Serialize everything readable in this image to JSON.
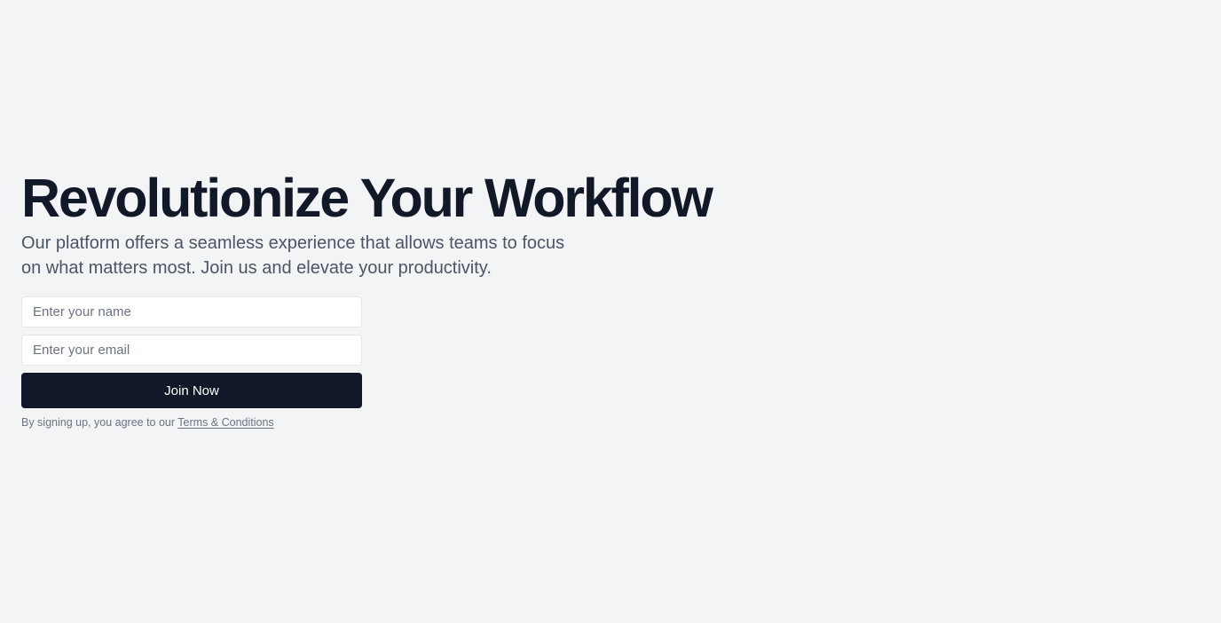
{
  "hero": {
    "title": "Revolutionize Your Workflow",
    "subtitle": "Our platform offers a seamless experience that allows teams to focus on what matters most. Join us and elevate your productivity."
  },
  "form": {
    "name_placeholder": "Enter your name",
    "email_placeholder": "Enter your email",
    "submit_label": "Join Now"
  },
  "legal": {
    "prefix": "By signing up, you agree to our",
    "link_label": "Terms & Conditions"
  },
  "colors": {
    "background": "#f3f4f6",
    "heading": "#111827",
    "body_text": "#4b5563",
    "button_bg": "#111827",
    "button_text": "#ffffff",
    "muted_text": "#6b7280"
  }
}
